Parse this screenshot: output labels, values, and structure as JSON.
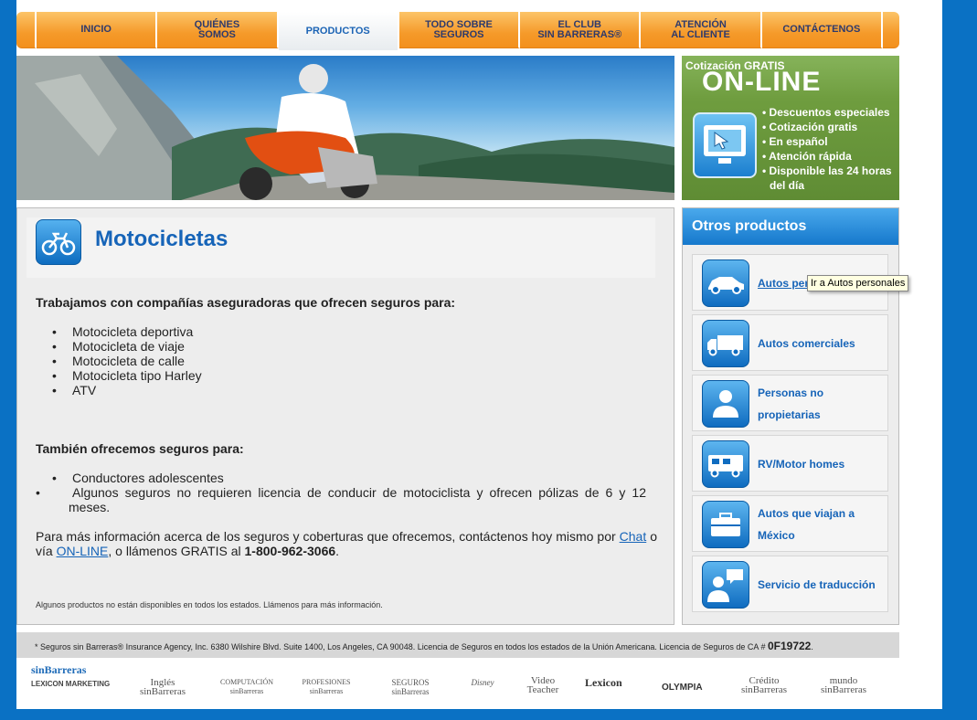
{
  "nav": {
    "tabs": [
      {
        "label": "INICIO"
      },
      {
        "label": "QUIÉNES\nSOMOS"
      },
      {
        "label": "PRODUCTOS"
      },
      {
        "label": "TODO SOBRE\nSEGUROS"
      },
      {
        "label": "EL CLUB\nSIN BARRERAS®"
      },
      {
        "label": "ATENCIÓN\nAL CLIENTE"
      },
      {
        "label": "CONTÁCTENOS"
      }
    ]
  },
  "promo": {
    "small": "Cotización GRATIS",
    "big": "ON-LINE",
    "bullets": [
      "• Descuentos especiales",
      "• Cotización gratis",
      "• En español",
      "• Atención rápida",
      "• Disponible las 24 horas",
      "  del día"
    ]
  },
  "main": {
    "title": "Motocicletas",
    "intro": "Trabajamos con compañías aseguradoras que ofrecen seguros para:",
    "types": [
      "Motocicleta deportiva",
      "Motocicleta de viaje",
      "Motocicleta de calle",
      "Motocicleta tipo Harley",
      "ATV"
    ],
    "also": "También ofrecemos seguros para:",
    "also_items": [
      "Conductores adolescentes",
      "Algunos seguros no requieren licencia de conducir de motociclista y ofrecen pólizas de 6 y 12 meses."
    ],
    "info_pre": "Para más información acerca de los seguros y coberturas que ofrecemos, contáctenos hoy mismo por",
    "chat": "Chat",
    "via": "o vía",
    "online": "ON-LINE",
    "call": ", o llámenos GRATIS al",
    "phone": "1-800-962-3066",
    "end": ".",
    "note": "Algunos productos no están disponibles en todos los estados. Llámenos para más información."
  },
  "side": {
    "title": "Otros productos",
    "products": [
      {
        "label": "Autos personales",
        "icon": "car-icon"
      },
      {
        "label": "Autos comerciales",
        "icon": "truck-icon"
      },
      {
        "label": "Personas no propietarias",
        "icon": "person-icon"
      },
      {
        "label": "RV/Motor homes",
        "icon": "rv-icon"
      },
      {
        "label": "Autos que viajan a México",
        "icon": "suitcase-icon"
      },
      {
        "label": "Servicio de traducción",
        "icon": "speech-person-icon"
      }
    ],
    "tooltip": "Ir a Autos personales",
    "first_visible": "Autos per"
  },
  "footer": {
    "text": "* Seguros sin Barreras® Insurance Agency, Inc. 6380 Wilshire Blvd. Suite 1400, Los Angeles, CA 90048. Licencia de Seguros en todos los estados de la Unión Americana. Licencia de Seguros de CA #",
    "license": "0F19722",
    "end": "."
  },
  "logos": [
    "sinBarreras",
    "LEXICON MARKETING",
    "Inglés sinBarreras",
    "COMPUTACIÓN sinBarreras",
    "PROFESIONES sinBarreras",
    "SEGUROS sinBarreras",
    "Disney",
    "Video Teacher",
    "Lexicon",
    "OLYMPIA",
    "Crédito sinBarreras",
    "mundo sinBarreras"
  ]
}
